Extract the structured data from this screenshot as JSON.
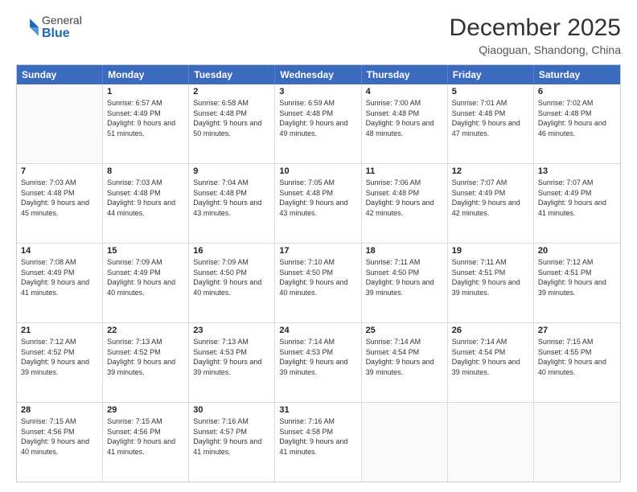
{
  "header": {
    "logo": {
      "general": "General",
      "blue": "Blue"
    },
    "title": "December 2025",
    "location": "Qiaoguan, Shandong, China"
  },
  "calendar": {
    "days_of_week": [
      "Sunday",
      "Monday",
      "Tuesday",
      "Wednesday",
      "Thursday",
      "Friday",
      "Saturday"
    ],
    "weeks": [
      [
        {
          "day": "",
          "empty": true
        },
        {
          "day": "1",
          "sunrise": "6:57 AM",
          "sunset": "4:49 PM",
          "daylight": "9 hours and 51 minutes."
        },
        {
          "day": "2",
          "sunrise": "6:58 AM",
          "sunset": "4:48 PM",
          "daylight": "9 hours and 50 minutes."
        },
        {
          "day": "3",
          "sunrise": "6:59 AM",
          "sunset": "4:48 PM",
          "daylight": "9 hours and 49 minutes."
        },
        {
          "day": "4",
          "sunrise": "7:00 AM",
          "sunset": "4:48 PM",
          "daylight": "9 hours and 48 minutes."
        },
        {
          "day": "5",
          "sunrise": "7:01 AM",
          "sunset": "4:48 PM",
          "daylight": "9 hours and 47 minutes."
        },
        {
          "day": "6",
          "sunrise": "7:02 AM",
          "sunset": "4:48 PM",
          "daylight": "9 hours and 46 minutes."
        }
      ],
      [
        {
          "day": "7",
          "sunrise": "7:03 AM",
          "sunset": "4:48 PM",
          "daylight": "9 hours and 45 minutes."
        },
        {
          "day": "8",
          "sunrise": "7:03 AM",
          "sunset": "4:48 PM",
          "daylight": "9 hours and 44 minutes."
        },
        {
          "day": "9",
          "sunrise": "7:04 AM",
          "sunset": "4:48 PM",
          "daylight": "9 hours and 43 minutes."
        },
        {
          "day": "10",
          "sunrise": "7:05 AM",
          "sunset": "4:48 PM",
          "daylight": "9 hours and 43 minutes."
        },
        {
          "day": "11",
          "sunrise": "7:06 AM",
          "sunset": "4:48 PM",
          "daylight": "9 hours and 42 minutes."
        },
        {
          "day": "12",
          "sunrise": "7:07 AM",
          "sunset": "4:49 PM",
          "daylight": "9 hours and 42 minutes."
        },
        {
          "day": "13",
          "sunrise": "7:07 AM",
          "sunset": "4:49 PM",
          "daylight": "9 hours and 41 minutes."
        }
      ],
      [
        {
          "day": "14",
          "sunrise": "7:08 AM",
          "sunset": "4:49 PM",
          "daylight": "9 hours and 41 minutes."
        },
        {
          "day": "15",
          "sunrise": "7:09 AM",
          "sunset": "4:49 PM",
          "daylight": "9 hours and 40 minutes."
        },
        {
          "day": "16",
          "sunrise": "7:09 AM",
          "sunset": "4:50 PM",
          "daylight": "9 hours and 40 minutes."
        },
        {
          "day": "17",
          "sunrise": "7:10 AM",
          "sunset": "4:50 PM",
          "daylight": "9 hours and 40 minutes."
        },
        {
          "day": "18",
          "sunrise": "7:11 AM",
          "sunset": "4:50 PM",
          "daylight": "9 hours and 39 minutes."
        },
        {
          "day": "19",
          "sunrise": "7:11 AM",
          "sunset": "4:51 PM",
          "daylight": "9 hours and 39 minutes."
        },
        {
          "day": "20",
          "sunrise": "7:12 AM",
          "sunset": "4:51 PM",
          "daylight": "9 hours and 39 minutes."
        }
      ],
      [
        {
          "day": "21",
          "sunrise": "7:12 AM",
          "sunset": "4:52 PM",
          "daylight": "9 hours and 39 minutes."
        },
        {
          "day": "22",
          "sunrise": "7:13 AM",
          "sunset": "4:52 PM",
          "daylight": "9 hours and 39 minutes."
        },
        {
          "day": "23",
          "sunrise": "7:13 AM",
          "sunset": "4:53 PM",
          "daylight": "9 hours and 39 minutes."
        },
        {
          "day": "24",
          "sunrise": "7:14 AM",
          "sunset": "4:53 PM",
          "daylight": "9 hours and 39 minutes."
        },
        {
          "day": "25",
          "sunrise": "7:14 AM",
          "sunset": "4:54 PM",
          "daylight": "9 hours and 39 minutes."
        },
        {
          "day": "26",
          "sunrise": "7:14 AM",
          "sunset": "4:54 PM",
          "daylight": "9 hours and 39 minutes."
        },
        {
          "day": "27",
          "sunrise": "7:15 AM",
          "sunset": "4:55 PM",
          "daylight": "9 hours and 40 minutes."
        }
      ],
      [
        {
          "day": "28",
          "sunrise": "7:15 AM",
          "sunset": "4:56 PM",
          "daylight": "9 hours and 40 minutes."
        },
        {
          "day": "29",
          "sunrise": "7:15 AM",
          "sunset": "4:56 PM",
          "daylight": "9 hours and 41 minutes."
        },
        {
          "day": "30",
          "sunrise": "7:16 AM",
          "sunset": "4:57 PM",
          "daylight": "9 hours and 41 minutes."
        },
        {
          "day": "31",
          "sunrise": "7:16 AM",
          "sunset": "4:58 PM",
          "daylight": "9 hours and 41 minutes."
        },
        {
          "day": "",
          "empty": true
        },
        {
          "day": "",
          "empty": true
        },
        {
          "day": "",
          "empty": true
        }
      ]
    ]
  }
}
